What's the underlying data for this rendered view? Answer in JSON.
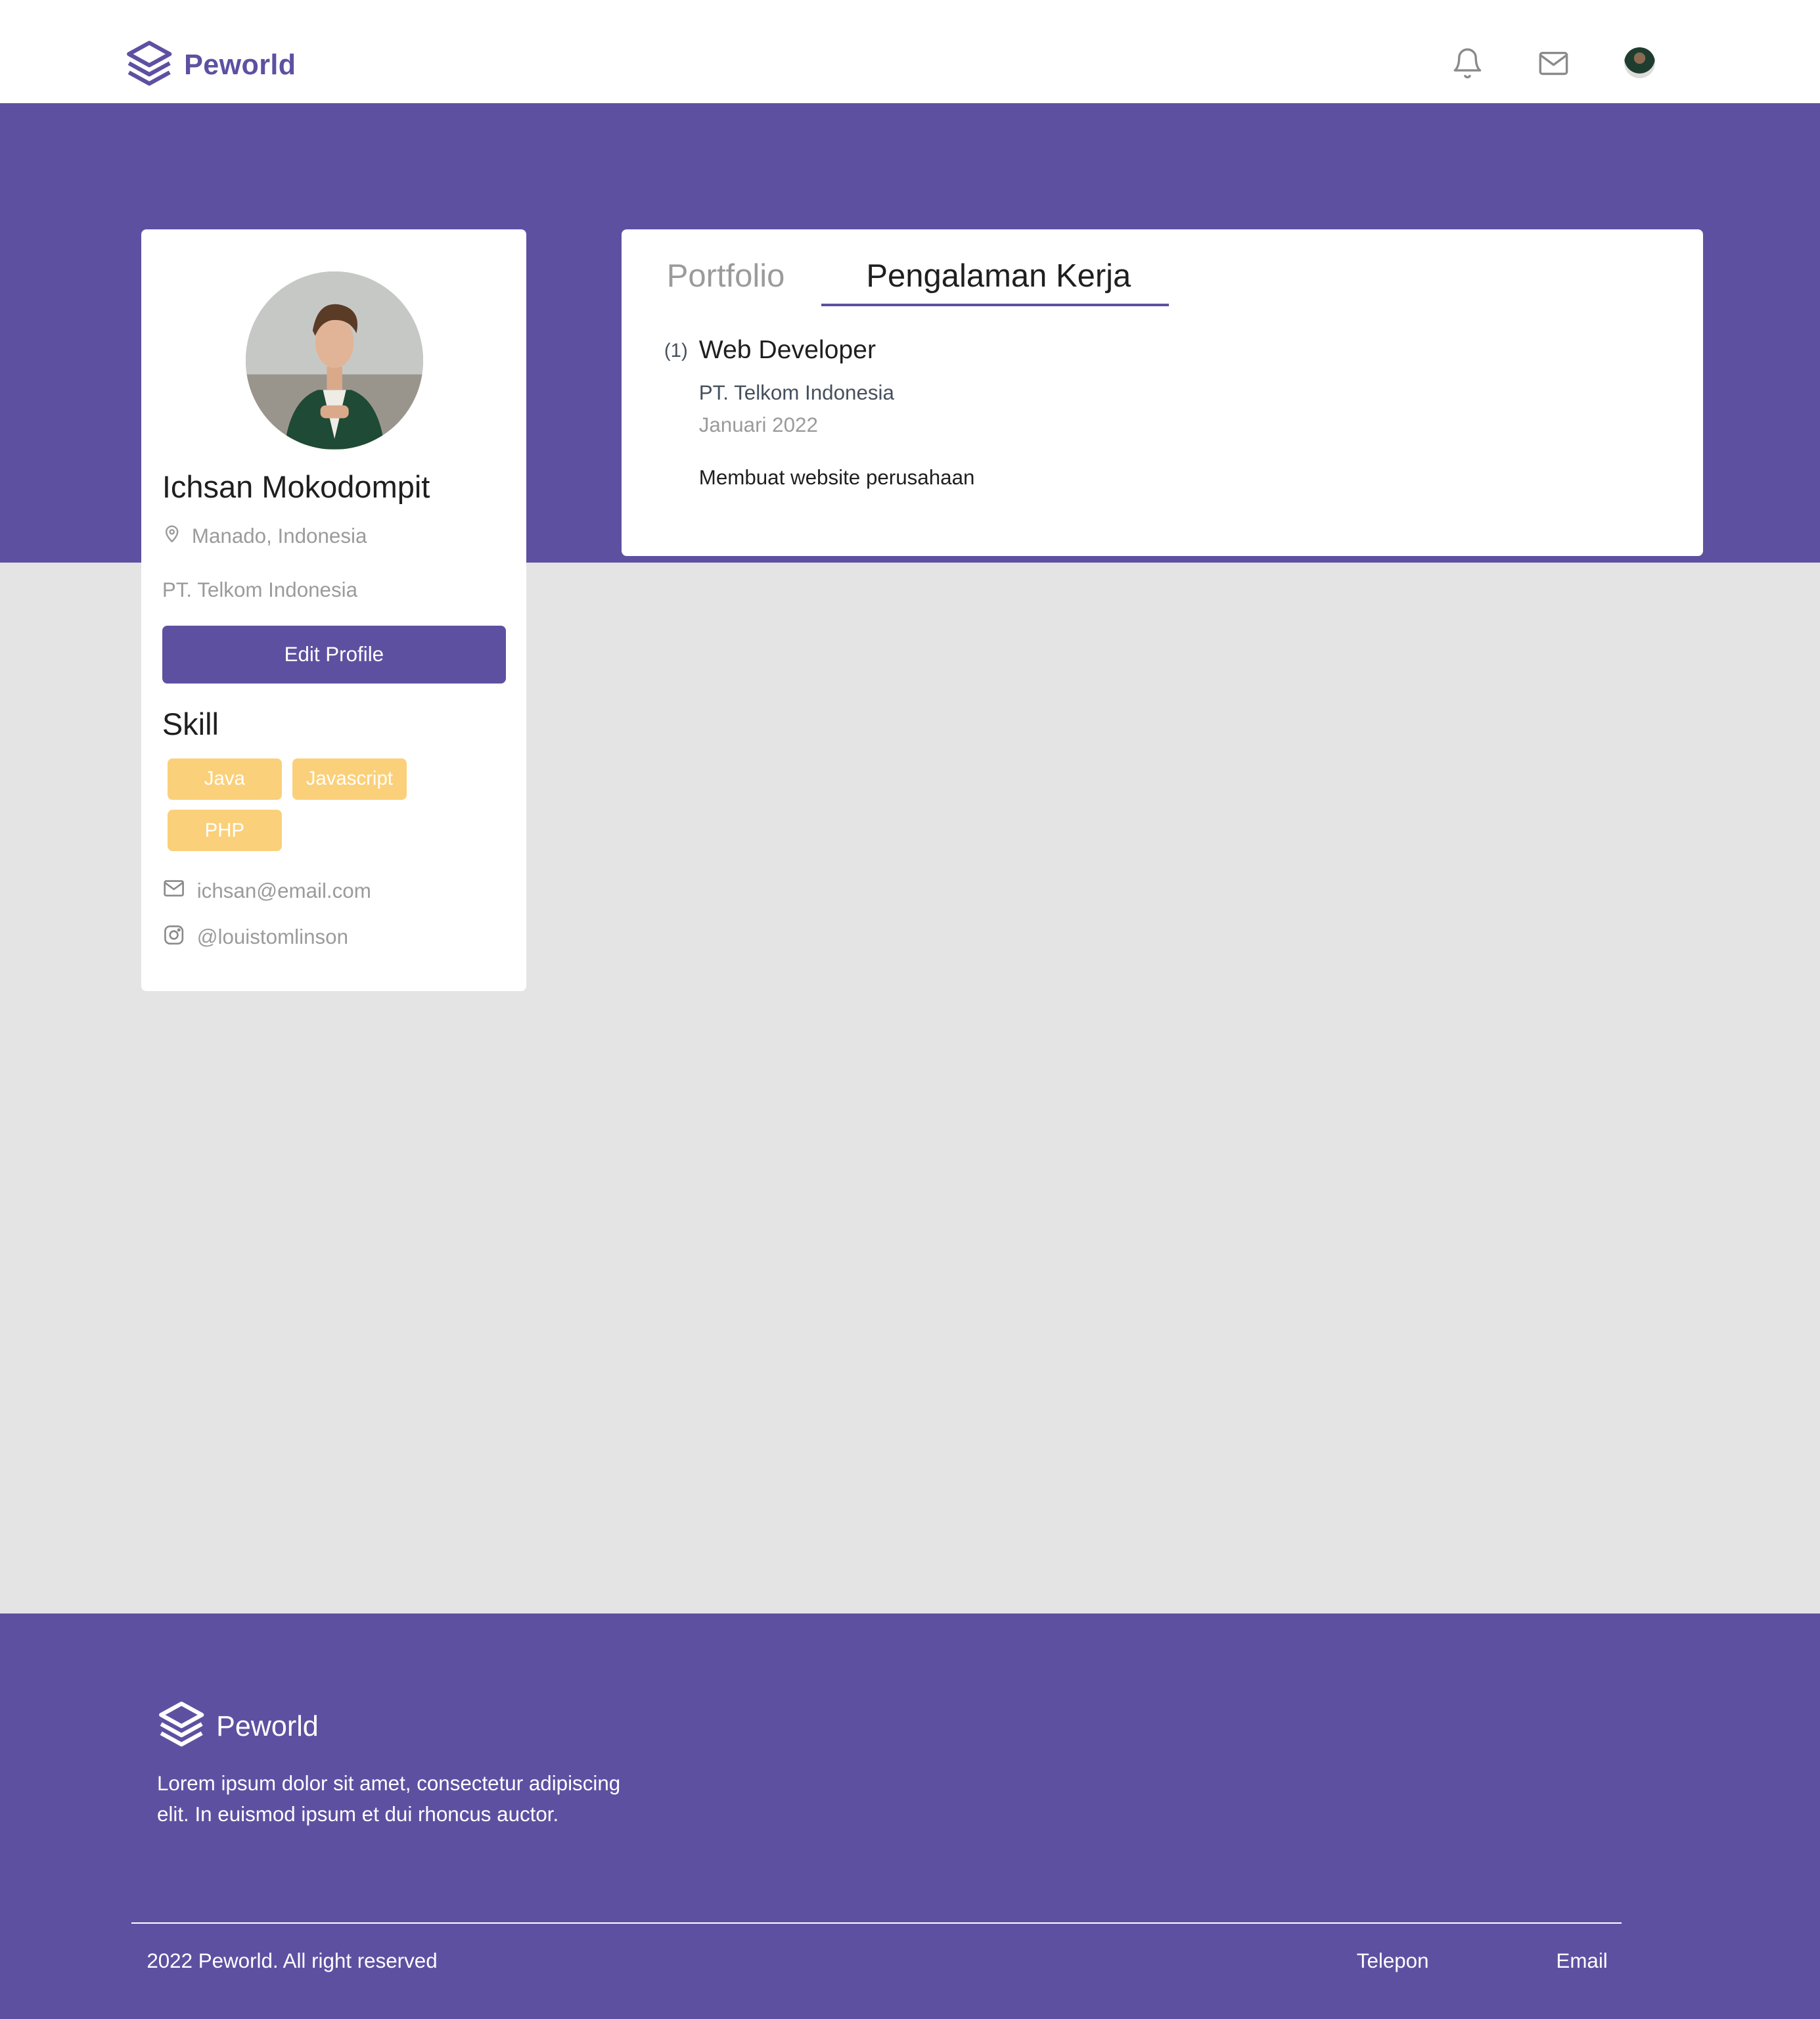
{
  "header": {
    "brand": "Peworld"
  },
  "profile": {
    "name": "Ichsan Mokodompit",
    "location": "Manado, Indonesia",
    "company": "PT. Telkom Indonesia",
    "edit_label": "Edit Profile",
    "skill_title": "Skill",
    "skills": [
      "Java",
      "Javascript",
      "PHP"
    ],
    "email": "ichsan@email.com",
    "instagram": "@louistomlinson"
  },
  "experience": {
    "tabs": [
      "Portfolio",
      "Pengalaman Kerja"
    ],
    "active_tab": "Pengalaman Kerja",
    "items": [
      {
        "number": "(1)",
        "position": "Web Developer",
        "company": "PT. Telkom Indonesia",
        "date": "Januari 2022",
        "description": "Membuat website perusahaan"
      }
    ]
  },
  "footer": {
    "brand": "Peworld",
    "description": "Lorem ipsum dolor sit amet, consectetur adipiscing elit. In euismod ipsum et dui rhoncus auctor.",
    "copyright": "2022 Peworld. All right reserved",
    "links": [
      "Telepon",
      "Email"
    ]
  },
  "colors": {
    "primary": "#5e50a1",
    "skill_chip": "#fbd07a",
    "background": "#e4e4e4"
  }
}
